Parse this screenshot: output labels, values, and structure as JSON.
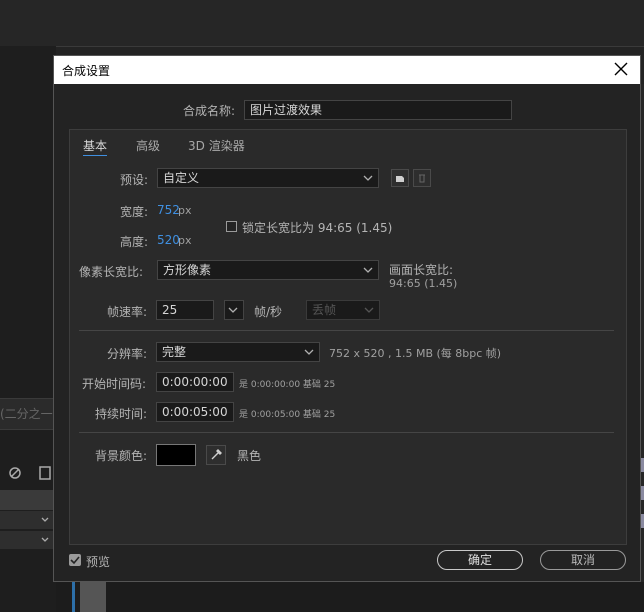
{
  "background": {
    "partial_label": "(二分之一"
  },
  "dialog": {
    "title": "合成设置",
    "close_icon": "close-icon",
    "comp_name_label": "合成名称:",
    "comp_name_value": "图片过渡效果",
    "tabs": [
      {
        "label": "基本",
        "active": true
      },
      {
        "label": "高级",
        "active": false
      },
      {
        "label": "3D 渲染器",
        "active": false
      }
    ],
    "preset": {
      "label": "预设:",
      "value": "自定义"
    },
    "width": {
      "label": "宽度:",
      "value": "752",
      "unit": "px"
    },
    "height": {
      "label": "高度:",
      "value": "520",
      "unit": "px"
    },
    "lock_aspect": {
      "label": "锁定长宽比为 94:65 (1.45)",
      "checked": false
    },
    "pixel_aspect": {
      "label": "像素长宽比:",
      "value": "方形像素"
    },
    "frame_aspect": {
      "label": "画面长宽比:",
      "value": "94:65 (1.45)"
    },
    "frame_rate": {
      "label": "帧速率:",
      "value": "25",
      "unit": "帧/秒",
      "mode": "丢帧"
    },
    "resolution": {
      "label": "分辨率:",
      "value": "完整",
      "info": "752 x 520 , 1.5 MB (每 8bpc 帧)"
    },
    "start_timecode": {
      "label": "开始时间码:",
      "value": "0:00:00:00",
      "note": "是 0:00:00:00  基础 25"
    },
    "duration": {
      "label": "持续时间:",
      "value": "0:00:05:00",
      "note": "是 0:00:05:00  基础 25"
    },
    "background_color": {
      "label": "背景颜色:",
      "color": "#000000",
      "name": "黑色"
    },
    "preview": {
      "label": "预览",
      "checked": true
    },
    "ok_label": "确定",
    "cancel_label": "取消"
  },
  "colors": {
    "accent_blue": "#3f8fe0",
    "dialog_bg": "#232323",
    "inner_bg": "#2a2a2a"
  }
}
